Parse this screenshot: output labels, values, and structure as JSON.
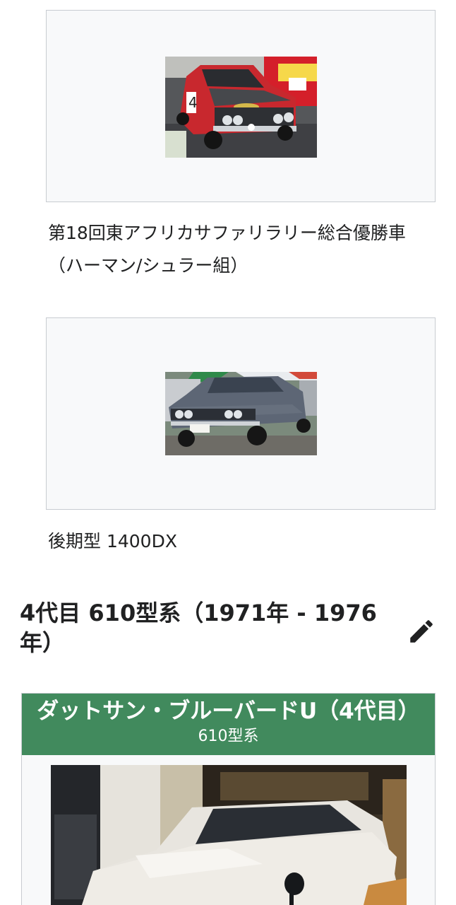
{
  "gallery": [
    {
      "caption_line1": "第18回東アフリカサファリラリー総合優勝車",
      "caption_line2": "（ハーマン/シュラー組）"
    },
    {
      "caption_line1": "後期型 1400DX"
    }
  ],
  "section": {
    "heading_line1": "4代目 610型系（1971年 - 1976",
    "heading_line2": "年）",
    "edit_icon": "pencil-icon"
  },
  "infobox": {
    "title": "ダットサン・ブルーバードU（4代目）",
    "subtitle": "610型系",
    "header_color": "#418a5d"
  },
  "colors": {
    "box_bg": "#f8f9fa",
    "box_border": "#c8ccd1",
    "text": "#202122"
  }
}
